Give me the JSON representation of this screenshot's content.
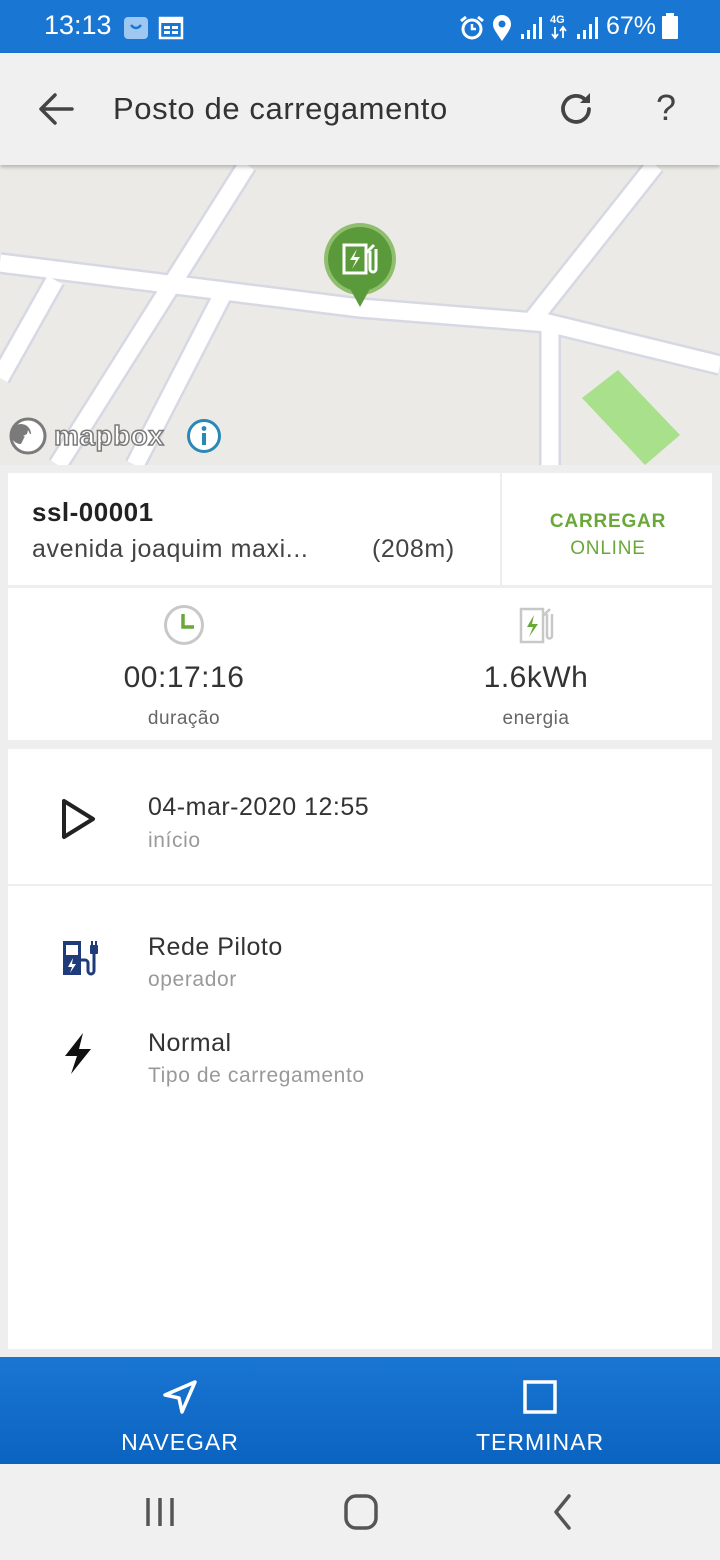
{
  "status_bar": {
    "time": "13:13",
    "battery": "67%",
    "icons": [
      "bag-icon",
      "calendar-icon",
      "alarm-icon",
      "location-icon",
      "signal-icon",
      "4g-icon",
      "signal-icon",
      "battery-icon"
    ]
  },
  "app_bar": {
    "title": "Posto de carregamento",
    "help": "?",
    "icons": {
      "back": "arrow-back-icon",
      "refresh": "refresh-icon"
    }
  },
  "map": {
    "attribution": "mapbox",
    "marker_icon": "charging-station-icon"
  },
  "station": {
    "id": "ssl-00001",
    "address": "avenida joaquim maxi...",
    "distance": "(208m)",
    "action": "CARREGAR",
    "status": "ONLINE"
  },
  "stats": {
    "duration": {
      "value": "00:17:16",
      "label": "duração",
      "icon": "clock-icon"
    },
    "energy": {
      "value": "1.6kWh",
      "label": "energia",
      "icon": "charging-station-icon"
    }
  },
  "details": {
    "start": {
      "value": "04-mar-2020 12:55",
      "label": "início",
      "icon": "play-icon"
    },
    "operator": {
      "value": "Rede Piloto",
      "label": "operador",
      "icon": "ev-charger-icon"
    },
    "charge_type": {
      "value": "Normal",
      "label": "Tipo de carregamento",
      "icon": "lightning-icon"
    }
  },
  "actions": {
    "navigate": "NAVEGAR",
    "stop": "TERMINAR"
  },
  "colors": {
    "primary": "#1976d2",
    "accent_green": "#6aa83a",
    "pin_green": "#5b9a3a",
    "park_green": "#a8e08c"
  }
}
